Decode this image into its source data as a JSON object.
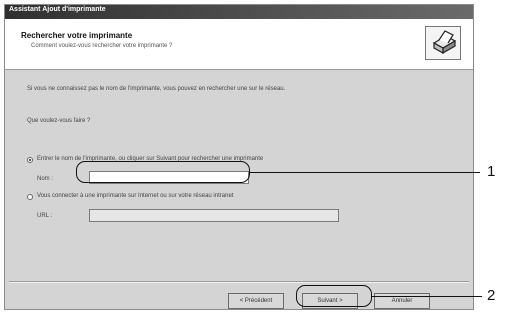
{
  "window": {
    "title": "Assistant Ajout d'imprimante"
  },
  "header": {
    "title": "Rechercher votre imprimante",
    "subtitle": "Comment voulez-vous rechercher votre imprimante ?",
    "icon": "printer-icon"
  },
  "body": {
    "intro": "Si vous ne connaissez pas le nom de l'imprimante, vous pouvez en rechercher une sur le réseau.",
    "question": "Que voulez-vous faire ?",
    "options": [
      {
        "label": "Entrer le nom de l'imprimante, ou cliquer sur Suivant pour rechercher une imprimante",
        "selected": true
      },
      {
        "label": "Vous connecter à une imprimante sur Internet ou sur votre réseau intranet",
        "selected": false
      }
    ],
    "name_field": {
      "label": "Nom :",
      "value": ""
    },
    "url_field": {
      "label": "URL :",
      "value": ""
    }
  },
  "buttons": {
    "back": "< Précédent",
    "next": "Suivant >",
    "cancel": "Annuler"
  },
  "callouts": [
    "1",
    "2"
  ]
}
